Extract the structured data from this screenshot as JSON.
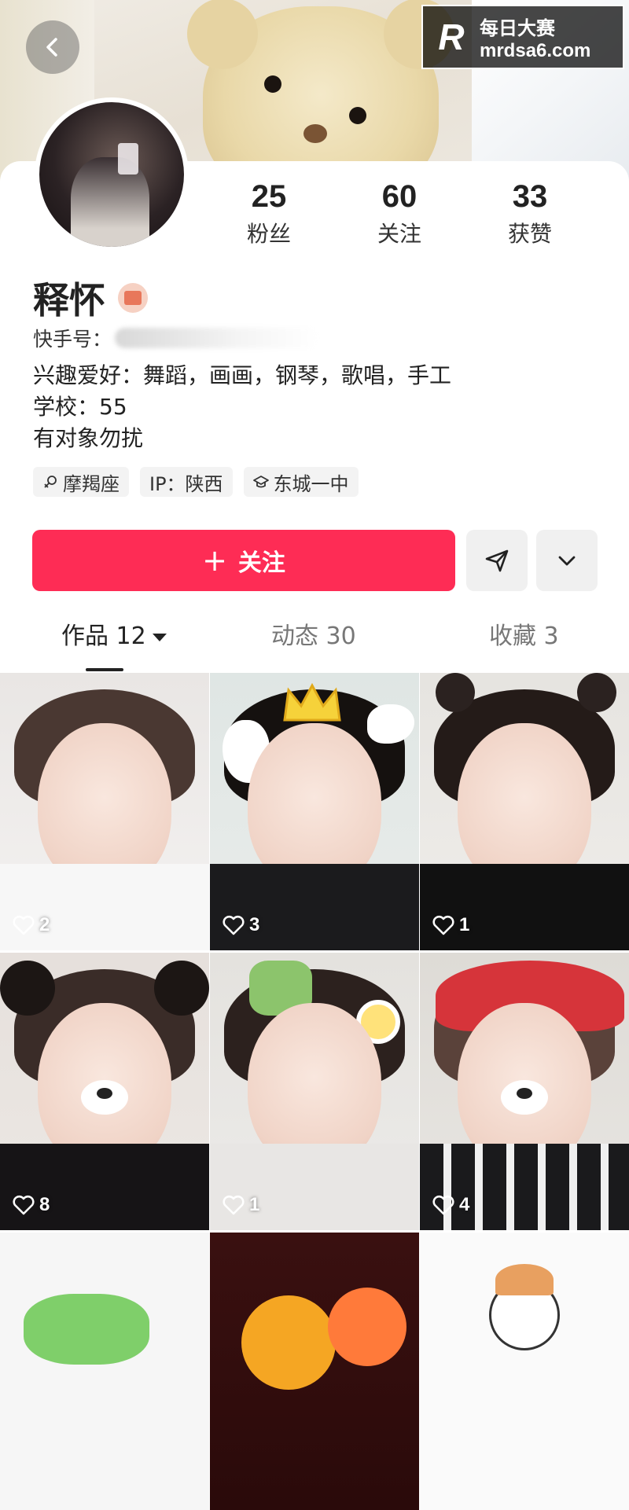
{
  "watermark": {
    "logo": "R",
    "title": "每日大赛",
    "url": "mrdsa6.com"
  },
  "profile": {
    "name": "释怀",
    "kuaishou_id_label": "快手号：",
    "stats": [
      {
        "value": "25",
        "label": "粉丝"
      },
      {
        "value": "60",
        "label": "关注"
      },
      {
        "value": "33",
        "label": "获赞"
      }
    ],
    "bio": [
      "兴趣爱好：舞蹈，画画，钢琴，歌唱，手工",
      "学校：55",
      "有对象勿扰"
    ],
    "tags": [
      {
        "icon": "zodiac-icon",
        "label": "摩羯座"
      },
      {
        "icon": "",
        "label": "IP：陕西"
      },
      {
        "icon": "school-icon",
        "label": "东城一中"
      }
    ]
  },
  "actions": {
    "follow_plus": "+",
    "follow_label": "关注"
  },
  "tabs": [
    {
      "label": "作品 12",
      "active": true
    },
    {
      "label": "动态 30",
      "active": false
    },
    {
      "label": "收藏 3",
      "active": false
    }
  ],
  "posts": [
    {
      "likes": "2"
    },
    {
      "likes": "3"
    },
    {
      "likes": "1"
    },
    {
      "likes": "8"
    },
    {
      "likes": "1"
    },
    {
      "likes": "4"
    },
    {
      "likes": ""
    },
    {
      "likes": ""
    },
    {
      "likes": ""
    }
  ],
  "colors": {
    "accent": "#fe2c55",
    "text": "#222222",
    "muted": "#777777",
    "tag_bg": "#f3f3f3"
  }
}
